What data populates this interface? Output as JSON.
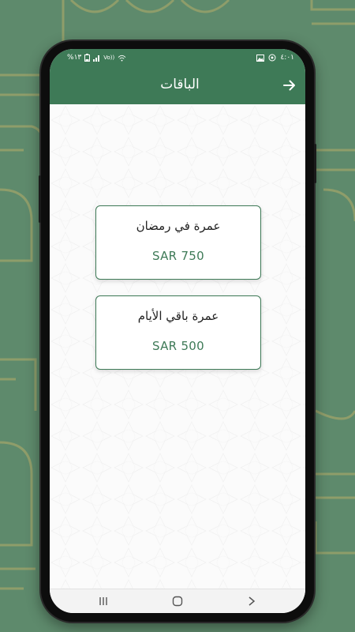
{
  "status_bar": {
    "battery_percent": "%١٣",
    "time": "٤:٠١",
    "network": "Vo))"
  },
  "app_bar": {
    "title": "الباقات"
  },
  "packages": [
    {
      "title": "عمرة في رمضان",
      "price": "SAR 750"
    },
    {
      "title": "عمرة باقي الأيام",
      "price": "SAR 500"
    }
  ],
  "colors": {
    "primary": "#3e7a57",
    "background": "#5e8a6c",
    "pattern": "#b7ad6a"
  },
  "icons": {
    "back": "arrow-right-icon",
    "nav_recents": "recents-icon",
    "nav_home": "home-icon",
    "nav_back": "chevron-right-icon"
  }
}
